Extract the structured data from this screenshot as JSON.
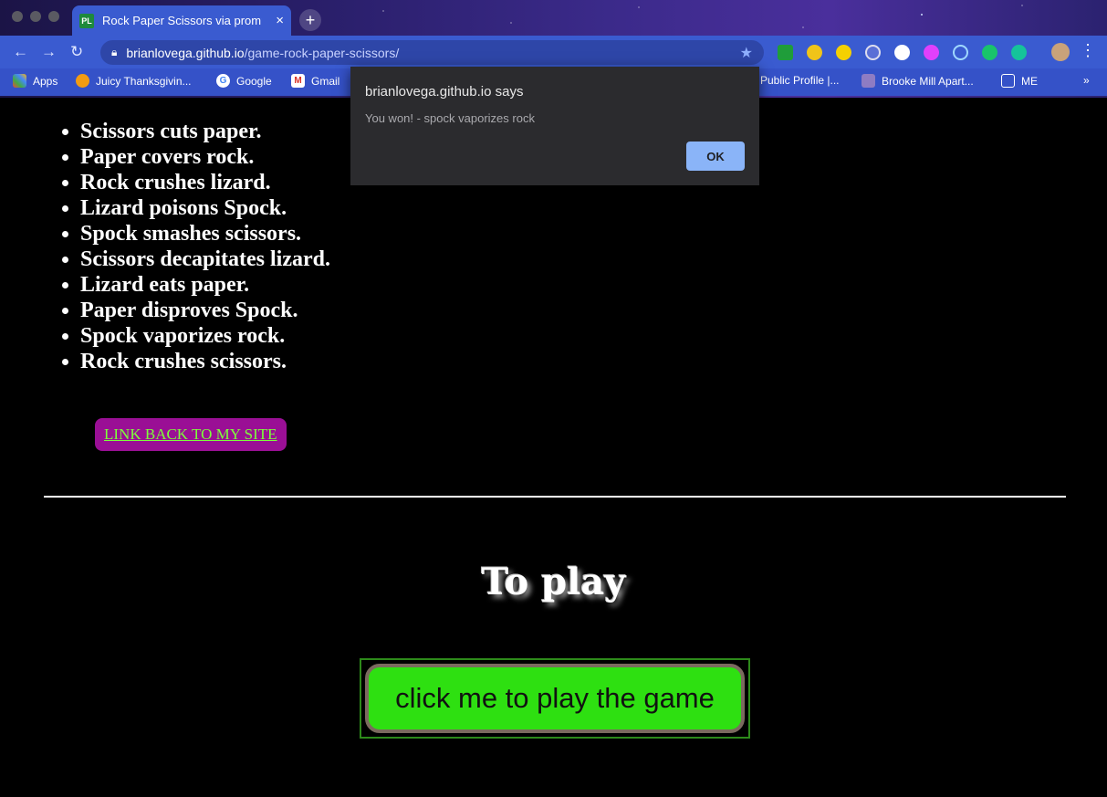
{
  "browser": {
    "tab_title": "Rock Paper Scissors via promp",
    "tab_favicon": "PL",
    "new_tab": "+",
    "url_host": "brianlovega.github.io",
    "url_path": "/game-rock-paper-scissors/",
    "bookmarks": [
      {
        "label": "Apps"
      },
      {
        "label": "Juicy Thanksgivin..."
      },
      {
        "label": "Google"
      },
      {
        "label": "Gmail"
      },
      {
        "label": "Public Profile |..."
      },
      {
        "label": "Brooke Mill Apart..."
      },
      {
        "label": "ME"
      }
    ],
    "overflow": "»"
  },
  "rules": [
    "Scissors cuts paper.",
    "Paper covers rock.",
    "Rock crushes lizard.",
    "Lizard poisons Spock.",
    "Spock smashes scissors.",
    "Scissors decapitates lizard.",
    "Lizard eats paper.",
    "Paper disproves Spock.",
    "Spock vaporizes rock.",
    "Rock crushes scissors."
  ],
  "site_link": "LINK BACK TO MY SITE",
  "to_play": "To play",
  "play_button": "click me to play the game",
  "dialog": {
    "title": "brianlovega.github.io says",
    "message": "You won! - spock vaporizes rock",
    "ok": "OK"
  },
  "colors": {
    "link_bg": "#9a0f95",
    "link_text": "#7cff3a",
    "play_bg": "#2ee011",
    "dialog_ok": "#8ab4f8"
  }
}
